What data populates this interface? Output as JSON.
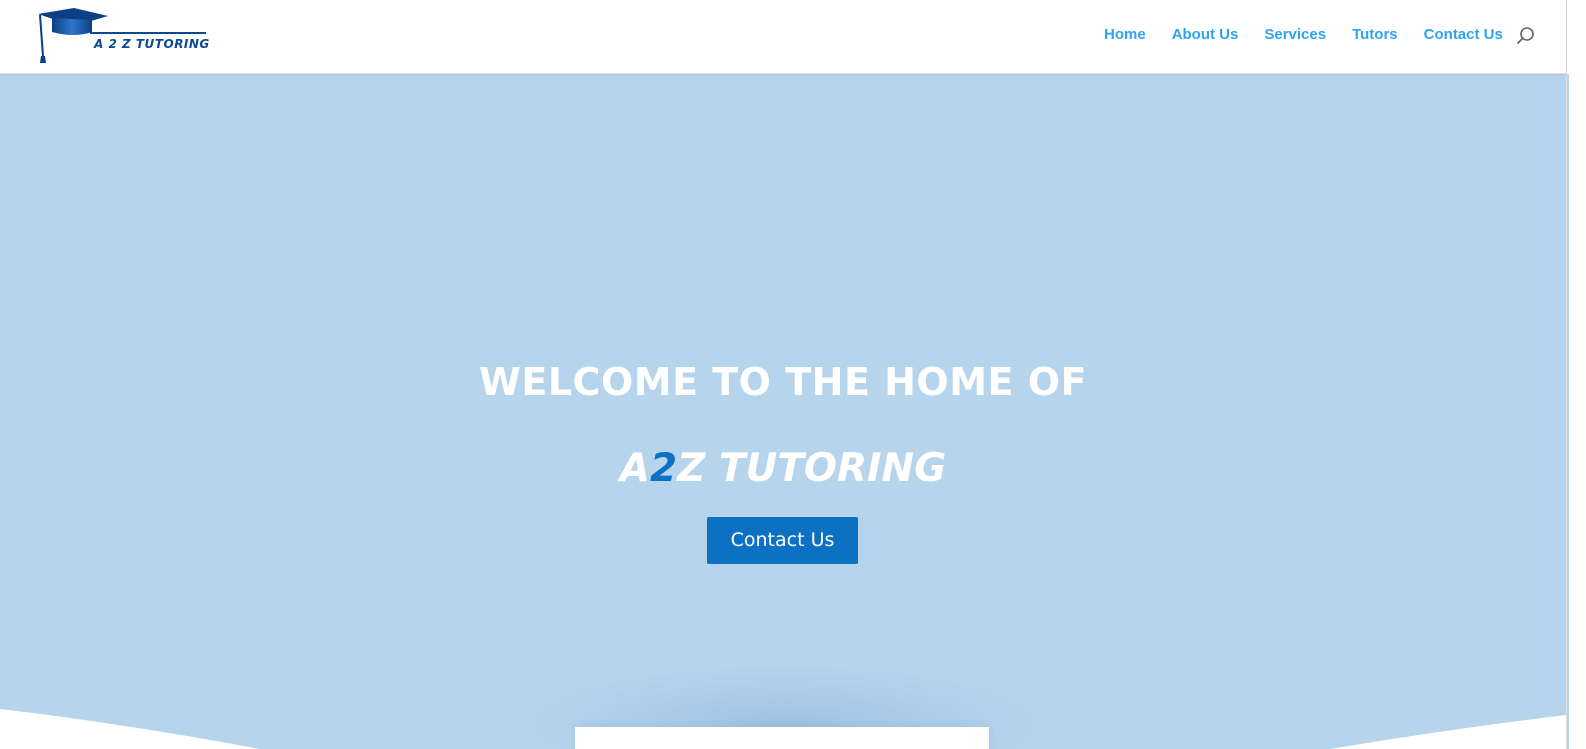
{
  "header": {
    "logo_text": "A 2 Z  TUTORING",
    "nav": [
      {
        "label": "Home"
      },
      {
        "label": "About Us"
      },
      {
        "label": "Services"
      },
      {
        "label": "Tutors"
      },
      {
        "label": "Contact Us"
      }
    ],
    "search_icon": "search-icon"
  },
  "hero": {
    "title": "WELCOME TO THE HOME OF",
    "brand_prefix": "A",
    "brand_accent": "2",
    "brand_suffix": "Z TUTORING",
    "cta_label": "Contact Us"
  },
  "colors": {
    "link": "#2ea3f2",
    "hero_bg": "#b7d4ed",
    "accent": "#0c71c3",
    "logo": "#0d4a94"
  }
}
